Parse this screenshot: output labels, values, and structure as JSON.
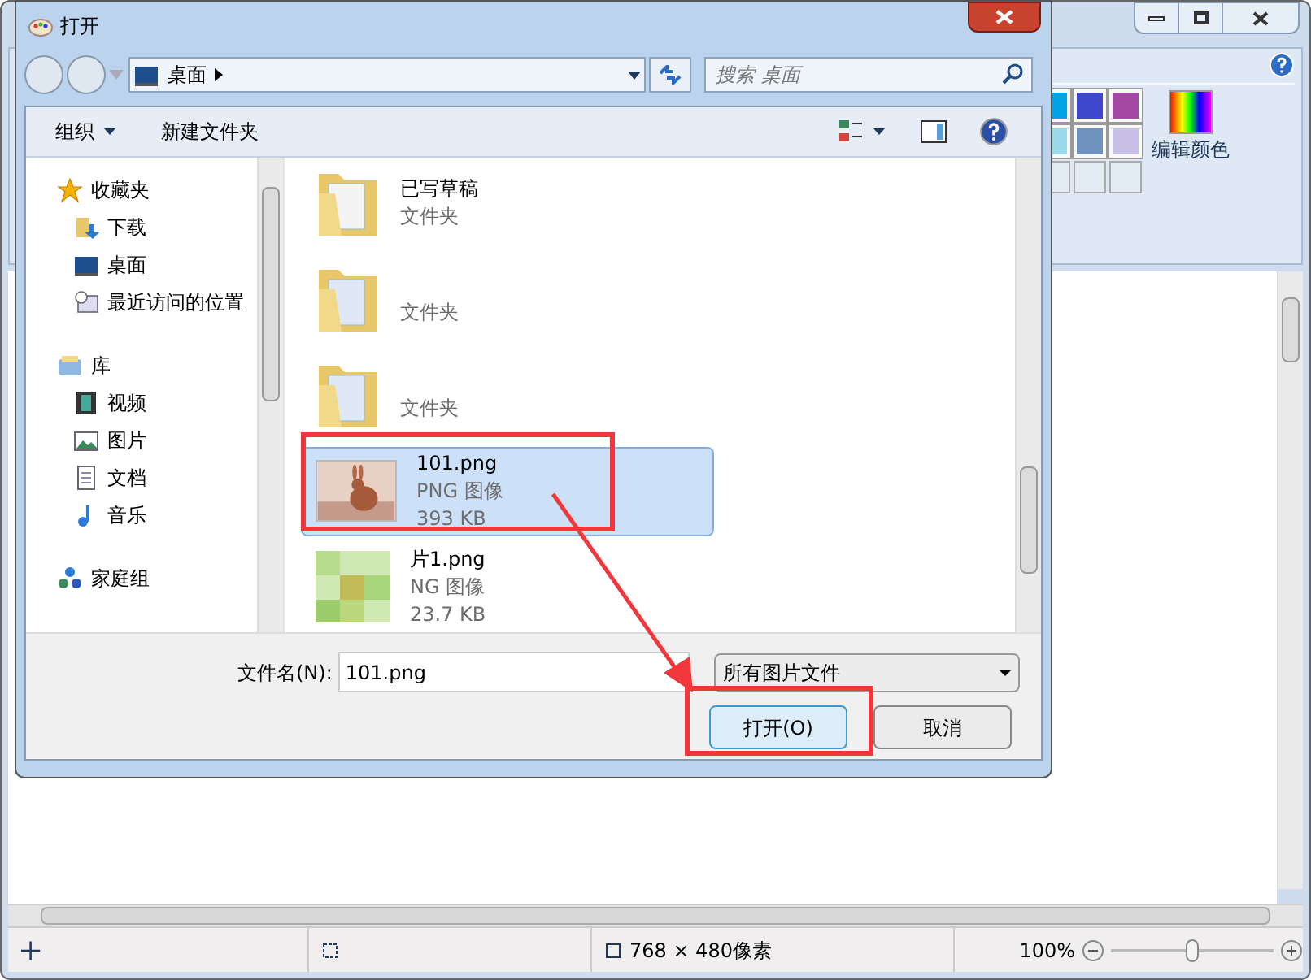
{
  "paint": {
    "palette": [
      {
        "color": "#00a2e8"
      },
      {
        "color": "#3f48cc"
      },
      {
        "color": "#a349a4"
      },
      {
        "color": "#99d9ea"
      },
      {
        "color": "#7092be"
      },
      {
        "color": "#c8bfe7"
      }
    ],
    "edit_colors": "编辑颜色",
    "status_bar": {
      "image_size": "768 × 480像素",
      "zoom": "100%",
      "level": 0.5
    }
  },
  "dialog": {
    "title": "打开",
    "address": "桌面",
    "search": {
      "placeholder": "搜索 桌面"
    },
    "toolbar": {
      "organize": "组织",
      "new_folder": "新建文件夹"
    },
    "nav": [
      {
        "label": "收藏夹",
        "kind": "star",
        "children": [
          {
            "label": "下载",
            "kind": "download"
          },
          {
            "label": "桌面",
            "kind": "desktop"
          },
          {
            "label": "最近访问的位置",
            "kind": "recent"
          }
        ]
      },
      {
        "label": "库",
        "kind": "library",
        "children": [
          {
            "label": "视频",
            "kind": "video"
          },
          {
            "label": "图片",
            "kind": "pictures"
          },
          {
            "label": "文档",
            "kind": "documents"
          },
          {
            "label": "音乐",
            "kind": "music"
          }
        ]
      },
      {
        "label": "家庭组",
        "kind": "homegroup"
      }
    ],
    "files": [
      {
        "kind": "folder",
        "name": "已写草稿",
        "type": "文件夹",
        "selected": false
      },
      {
        "kind": "folder",
        "type": "文件夹",
        "selected": false
      },
      {
        "kind": "folder",
        "type": "文件夹",
        "selected": false
      },
      {
        "name": "101.png",
        "type": "PNG 图像",
        "size": "393 KB",
        "selected": true
      },
      {
        "kind": "mosaic",
        "name": "片1.png",
        "type": "NG 图像",
        "size": "23.7 KB",
        "selected": false
      }
    ],
    "filename_label": "文件名(N):",
    "filename": "101.png",
    "filter": "所有图片文件",
    "buttons": [
      {
        "label": "打开(O)",
        "kind": "default"
      },
      {
        "label": "取消",
        "kind": "normal"
      }
    ]
  }
}
